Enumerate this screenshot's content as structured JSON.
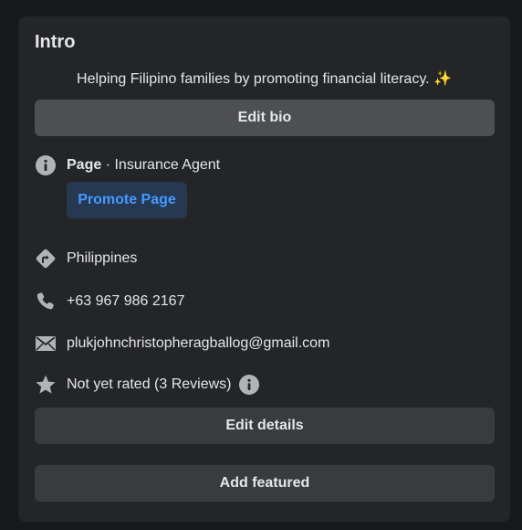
{
  "intro": {
    "title": "Intro",
    "bio": "Helping Filipino families by promoting financial literacy. ✨",
    "edit_bio_label": "Edit bio"
  },
  "category": {
    "prefix": "Page",
    "separator": " · ",
    "value": "Insurance Agent",
    "promote_label": "Promote Page",
    "icon": "info-icon"
  },
  "details": {
    "location": "Philippines",
    "location_icon": "directions-icon",
    "phone": "+63 967 986 2167",
    "phone_icon": "phone-icon",
    "email": "plukjohnchristopheragballog@gmail.com",
    "email_icon": "envelope-icon",
    "rating": "Not yet rated (3 Reviews)",
    "rating_icon": "star-icon"
  },
  "actions": {
    "edit_details_label": "Edit details",
    "add_featured_label": "Add featured"
  },
  "colors": {
    "background": "#18191a",
    "card": "#242526",
    "button": "#3a3b3c",
    "promote_bg": "#263951",
    "promote_text": "#4599ff",
    "icon": "#b0b3b8"
  }
}
